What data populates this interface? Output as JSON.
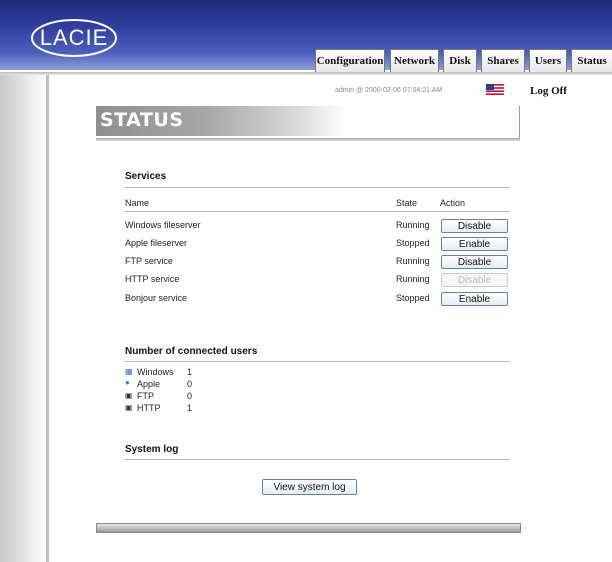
{
  "header": {
    "logo_text": "LACIE",
    "tabs": [
      "Configuration",
      "Network",
      "Disk",
      "Shares",
      "Users",
      "Status"
    ],
    "active_tab": "Status"
  },
  "userbar": {
    "info": "admin @ 2000-02-06 07:04:21 AM",
    "logoff": "Log Off"
  },
  "page_title": "STATUS",
  "services": {
    "title": "Services",
    "columns": {
      "name": "Name",
      "state": "State",
      "action": "Action"
    },
    "rows": [
      {
        "name": "Windows fileserver",
        "state": "Running",
        "action": "Disable",
        "enabled": true
      },
      {
        "name": "Apple fileserver",
        "state": "Stopped",
        "action": "Enable",
        "enabled": true
      },
      {
        "name": "FTP service",
        "state": "Running",
        "action": "Disable",
        "enabled": true
      },
      {
        "name": "HTTP service",
        "state": "Running",
        "action": "Disable",
        "enabled": false
      },
      {
        "name": "Bonjour service",
        "state": "Stopped",
        "action": "Enable",
        "enabled": true
      }
    ]
  },
  "users": {
    "title": "Number of connected users",
    "rows": [
      {
        "label": "Windows",
        "count": "1",
        "icon": "windows-icon"
      },
      {
        "label": "Apple",
        "count": "0",
        "icon": "apple-icon"
      },
      {
        "label": "FTP",
        "count": "0",
        "icon": "ftp-icon"
      },
      {
        "label": "HTTP",
        "count": "1",
        "icon": "http-icon"
      }
    ]
  },
  "syslog": {
    "title": "System log",
    "button": "View system log"
  },
  "colors": {
    "banner_dark": "#1f2a7a",
    "banner_light": "#8fa0d8",
    "button_border": "#6a7fa8"
  }
}
